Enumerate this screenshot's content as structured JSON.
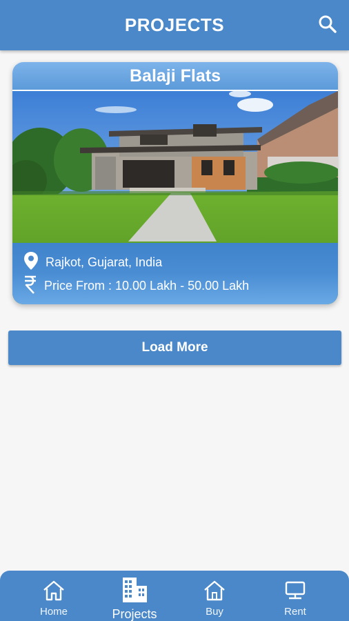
{
  "header": {
    "title": "PROJECTS",
    "search_icon": "search-icon"
  },
  "projects": [
    {
      "name": "Balaji Flats",
      "location": "Rajkot, Gujarat, India",
      "price": "Price From : 10.00 Lakh - 50.00 Lakh",
      "location_icon": "map-pin-icon",
      "price_icon": "rupee-icon"
    }
  ],
  "load_more_label": "Load More",
  "bottom_nav": {
    "items": [
      {
        "label": "Home",
        "icon": "home-icon",
        "active": false
      },
      {
        "label": "Projects",
        "icon": "buildings-icon",
        "active": true
      },
      {
        "label": "Buy",
        "icon": "house-icon",
        "active": false
      },
      {
        "label": "Rent",
        "icon": "monitor-icon",
        "active": false
      }
    ]
  },
  "colors": {
    "primary": "#4a88c9",
    "background": "#f6f6f6",
    "text_on_primary": "#ffffff"
  }
}
